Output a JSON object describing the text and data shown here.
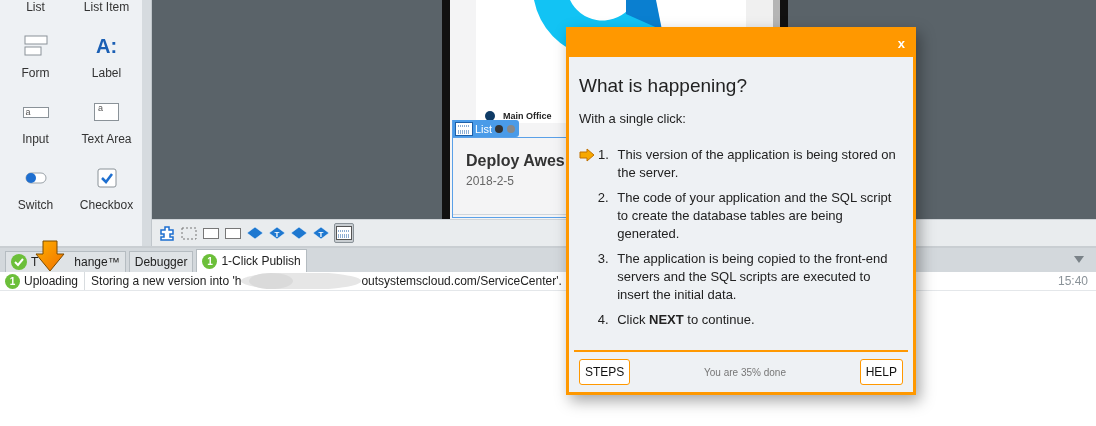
{
  "toolbox": {
    "items": [
      {
        "label": "List",
        "kind": "hidden"
      },
      {
        "label": "Form",
        "kind": "form"
      },
      {
        "label": "Input",
        "kind": "input",
        "glyph": "a"
      },
      {
        "label": "Switch",
        "kind": "switch"
      },
      {
        "label": "List Item",
        "kind": "hidden"
      },
      {
        "label": "Label",
        "kind": "label",
        "glyph": "A:"
      },
      {
        "label": "Text Area",
        "kind": "textarea",
        "glyph": "a"
      },
      {
        "label": "Checkbox",
        "kind": "checkbox"
      }
    ]
  },
  "canvas": {
    "legend": "Main Office",
    "list_tag": "List",
    "list_item": {
      "title": "Deploy Awes",
      "date": "2018-2-5"
    }
  },
  "canvas_toolbar": [
    {
      "kind": "puzzle",
      "selected": false
    },
    {
      "kind": "dashed",
      "selected": false
    },
    {
      "kind": "rect",
      "selected": false
    },
    {
      "kind": "rect",
      "selected": false
    },
    {
      "kind": "diamond",
      "selected": false
    },
    {
      "kind": "diamond",
      "glyph": "T",
      "selected": false
    },
    {
      "kind": "diamond",
      "selected": false
    },
    {
      "kind": "diamond",
      "glyph": "T",
      "selected": false
    },
    {
      "kind": "list",
      "selected": true
    }
  ],
  "panel": {
    "tabs": [
      {
        "label_parts": [
          "T",
          "hange™"
        ],
        "kind": "check",
        "selected": false
      },
      {
        "label": "Debugger",
        "selected": false
      },
      {
        "label": "1-Click Publish",
        "badge": "1",
        "selected": true
      }
    ],
    "log": [
      {
        "badge": "1",
        "status": "Uploading",
        "message_parts": [
          "Storing a new version into 'h",
          "outsystemscloud.com/ServiceCenter'."
        ],
        "time": "15:40"
      }
    ]
  },
  "dialog": {
    "close": "x",
    "title": "What is happening?",
    "intro": "With a single click:",
    "steps": [
      {
        "number": "1.",
        "text": "This version of the application is being stored on the server.",
        "current": true
      },
      {
        "number": "2.",
        "text": "The code of your application and the SQL script to create the database tables are being generated.",
        "current": false
      },
      {
        "number": "3.",
        "text": "The application is being copied to the front-end servers and the SQL scripts are executed to insert the initial data.",
        "current": false
      },
      {
        "number": "4.",
        "text": "Click **NEXT** to continue.",
        "current": false
      }
    ],
    "left_button": "STEPS",
    "progress": "You are 35% done",
    "right_button": "HELP"
  }
}
